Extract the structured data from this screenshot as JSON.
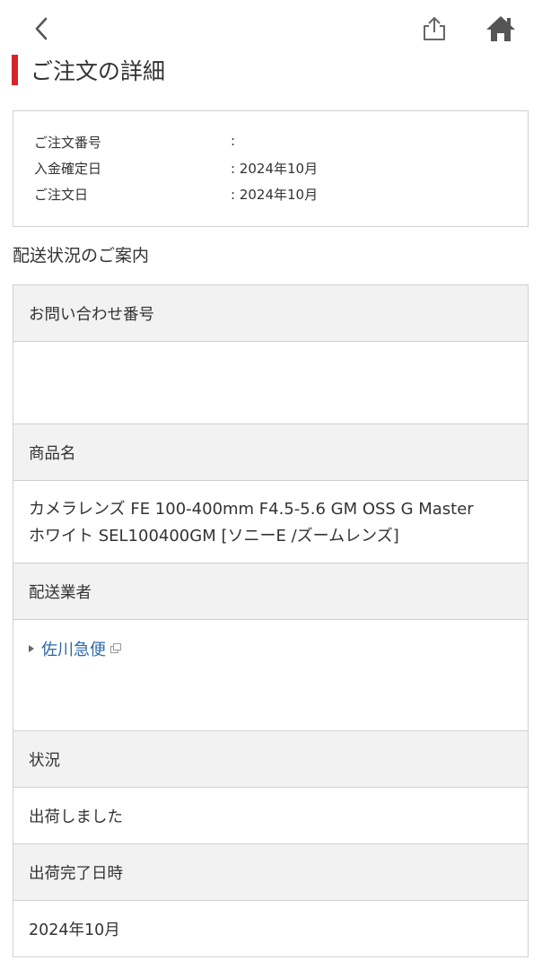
{
  "header": {
    "back_icon": "chevron-left-icon",
    "share_icon": "share-icon",
    "home_icon": "home-icon"
  },
  "page": {
    "title": "ご注文の詳細",
    "accent_color": "#d6242b"
  },
  "order_info": {
    "rows": [
      {
        "label": "ご注文番号",
        "value": ":"
      },
      {
        "label": "入金確定日",
        "value": ": 2024年10月"
      },
      {
        "label": "ご注文日",
        "value": ": 2024年10月"
      }
    ]
  },
  "shipping": {
    "heading": "配送状況のご案内",
    "inquiry_label": "お問い合わせ番号",
    "inquiry_value": "",
    "product_label": "商品名",
    "product_line1": "カメラレンズ FE 100-400mm F4.5-5.6 GM OSS G Master",
    "product_line2": "ホワイト SEL100400GM [ソニーE /ズームレンズ]",
    "carrier_label": "配送業者",
    "carrier_name": "佐川急便",
    "carrier_link_color": "#2a69a8",
    "status_label": "状況",
    "status_value": "出荷しました",
    "completed_label": "出荷完了日時",
    "completed_value": "2024年10月"
  }
}
